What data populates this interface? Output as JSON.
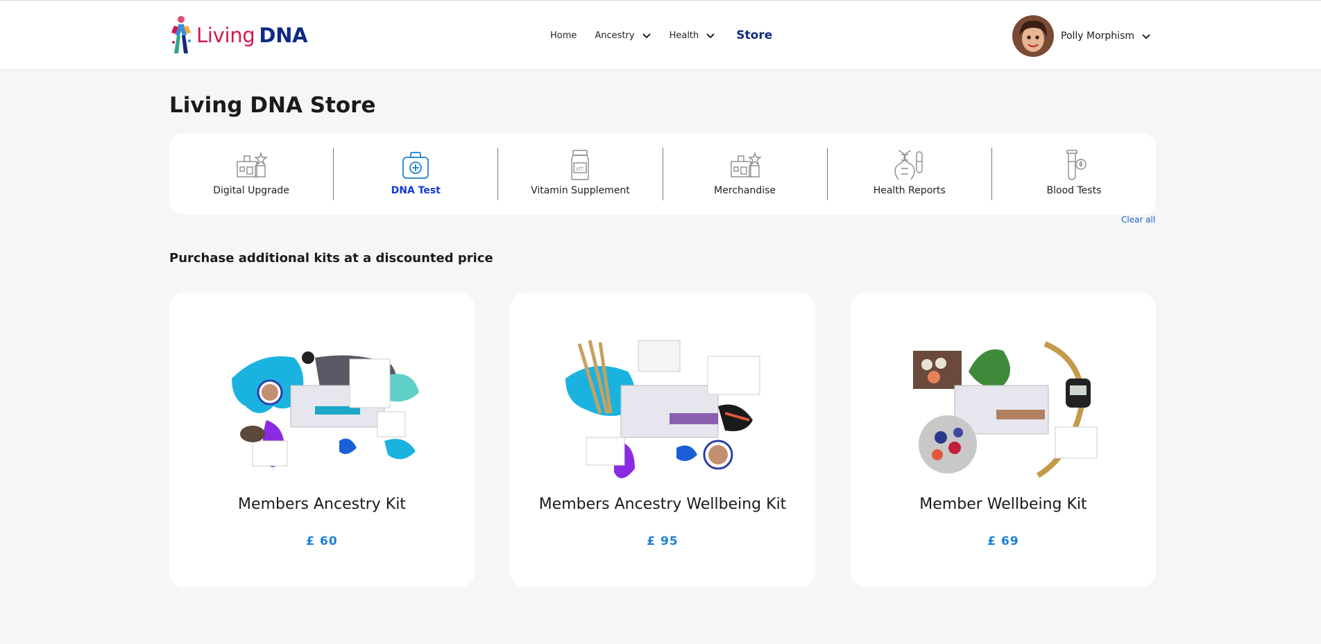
{
  "header": {
    "logo": {
      "word1": "Living",
      "word2": "DNA"
    },
    "nav": [
      {
        "label": "Home"
      },
      {
        "label": "Ancestry"
      },
      {
        "label": "Health"
      },
      {
        "label": "Store"
      }
    ],
    "user": {
      "name": "Polly Morphism"
    }
  },
  "page": {
    "title": "Living DNA Store"
  },
  "categories": [
    {
      "label": "Digital Upgrade",
      "icon": "digital-upgrade-icon"
    },
    {
      "label": "DNA Test",
      "icon": "dna-test-kit-icon",
      "active": true
    },
    {
      "label": "Vitamin Supplement",
      "icon": "vitamin-jar-icon"
    },
    {
      "label": "Merchandise",
      "icon": "merchandise-icon"
    },
    {
      "label": "Health Reports",
      "icon": "dna-helix-icon"
    },
    {
      "label": "Blood Tests",
      "icon": "test-tube-icon"
    }
  ],
  "clear_all": "Clear all",
  "section": {
    "title": "Purchase additional kits at a discounted price"
  },
  "products": [
    {
      "name": "Members Ancestry Kit",
      "price": "£ 60"
    },
    {
      "name": "Members Ancestry Wellbeing Kit",
      "price": "£ 95"
    },
    {
      "name": "Member Wellbeing Kit",
      "price": "£ 69"
    }
  ],
  "colors": {
    "brand_pink": "#d2174e",
    "brand_navy": "#102a83",
    "active_blue": "#1537d6",
    "price_blue": "#1a7fd6"
  }
}
